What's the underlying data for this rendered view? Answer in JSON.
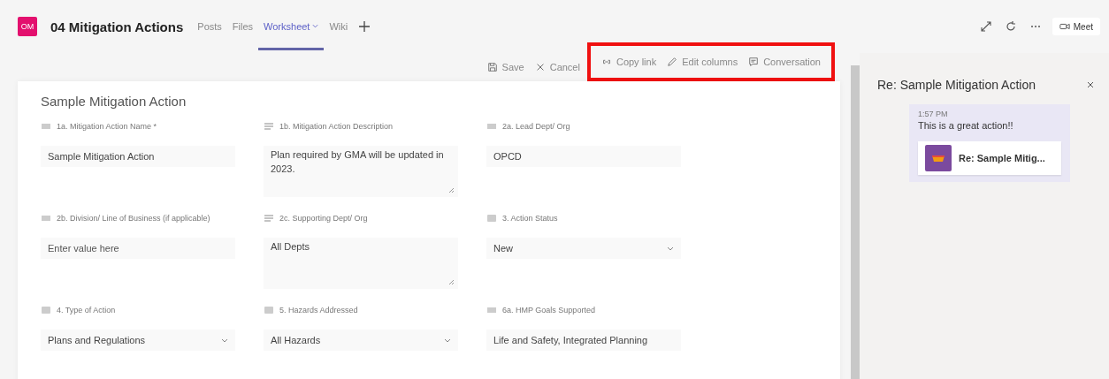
{
  "header": {
    "avatar": "OM",
    "title": "04 Mitigation Actions",
    "tabs": [
      {
        "label": "Posts",
        "selected": false,
        "has_menu": false
      },
      {
        "label": "Files",
        "selected": false,
        "has_menu": false
      },
      {
        "label": "Worksheet",
        "selected": true,
        "has_menu": true
      },
      {
        "label": "Wiki",
        "selected": false,
        "has_menu": false
      }
    ],
    "meet_button": "Meet"
  },
  "toolbar": [
    {
      "label": "Save",
      "kind": "save",
      "highlighted": false
    },
    {
      "label": "Cancel",
      "kind": "cancel",
      "highlighted": false
    },
    {
      "label": "Copy link",
      "kind": "link",
      "highlighted": true
    },
    {
      "label": "Edit columns",
      "kind": "edit",
      "highlighted": true
    },
    {
      "label": "Conversation",
      "kind": "conversation",
      "highlighted": true
    }
  ],
  "form": {
    "title": "Sample Mitigation Action",
    "fields": [
      {
        "label": "1a. Mitigation Action Name *",
        "kind": "text",
        "value": "Sample Mitigation Action"
      },
      {
        "label": "1b. Mitigation Action Description",
        "kind": "multiline",
        "value": "Plan required by GMA will be updated in 2023."
      },
      {
        "label": "2a. Lead Dept/ Org",
        "kind": "text",
        "value": "OPCD"
      },
      {
        "label": "2b. Division/ Line of Business (if applicable)",
        "kind": "text",
        "placeholder": "Enter value here"
      },
      {
        "label": "2c. Supporting Dept/ Org",
        "kind": "multiline",
        "value": "All Depts"
      },
      {
        "label": "3. Action Status",
        "kind": "dropdown",
        "value": "New"
      },
      {
        "label": "4. Type of Action",
        "kind": "dropdown",
        "value": "Plans and Regulations"
      },
      {
        "label": "5. Hazards Addressed",
        "kind": "dropdown",
        "value": "All Hazards"
      },
      {
        "label": "6a. HMP Goals Supported",
        "kind": "text",
        "value": "Life and Safety, Integrated Planning"
      }
    ]
  },
  "conversation": {
    "title": "Re: Sample Mitigation Action",
    "messages": [
      {
        "time": "1:57 PM",
        "text": "This is a great action!!",
        "attachment": "Re: Sample Mitig..."
      }
    ]
  }
}
